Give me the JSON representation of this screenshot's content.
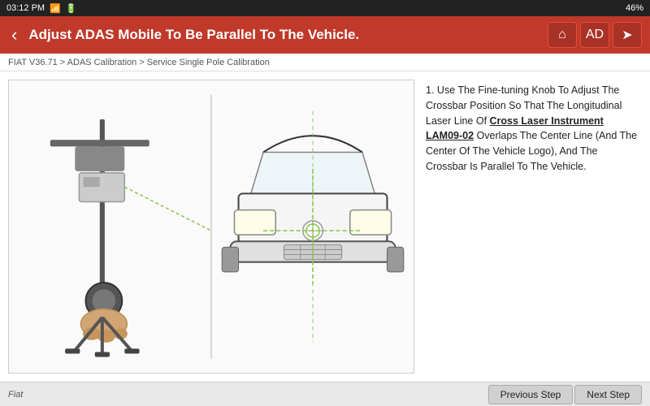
{
  "statusBar": {
    "time": "03:12 PM",
    "battery": "46%",
    "wifiIcon": "wifi",
    "batteryIcon": "battery"
  },
  "header": {
    "backLabel": "‹",
    "title": "Adjust ADAS Mobile To Be Parallel To The Vehicle.",
    "homeIcon": "🏠",
    "adasIcon": "AD",
    "forwardIcon": "➤"
  },
  "breadcrumb": {
    "text": "FIAT V36.71 > ADAS Calibration > Service Single Pole Calibration"
  },
  "instruction": {
    "number": "1.",
    "text1": " Use The Fine-tuning Knob To Adjust The Crossbar Position So That The Longitudinal Laser Line Of ",
    "linkText": "Cross Laser Instrument LAM09-02",
    "text2": " Overlaps The Center Line (And The Center Of The Vehicle Logo), And The Crossbar Is Parallel To The Vehicle."
  },
  "footer": {
    "brand": "Fiat",
    "previousStep": "Previous Step",
    "nextStep": "Next Step"
  }
}
